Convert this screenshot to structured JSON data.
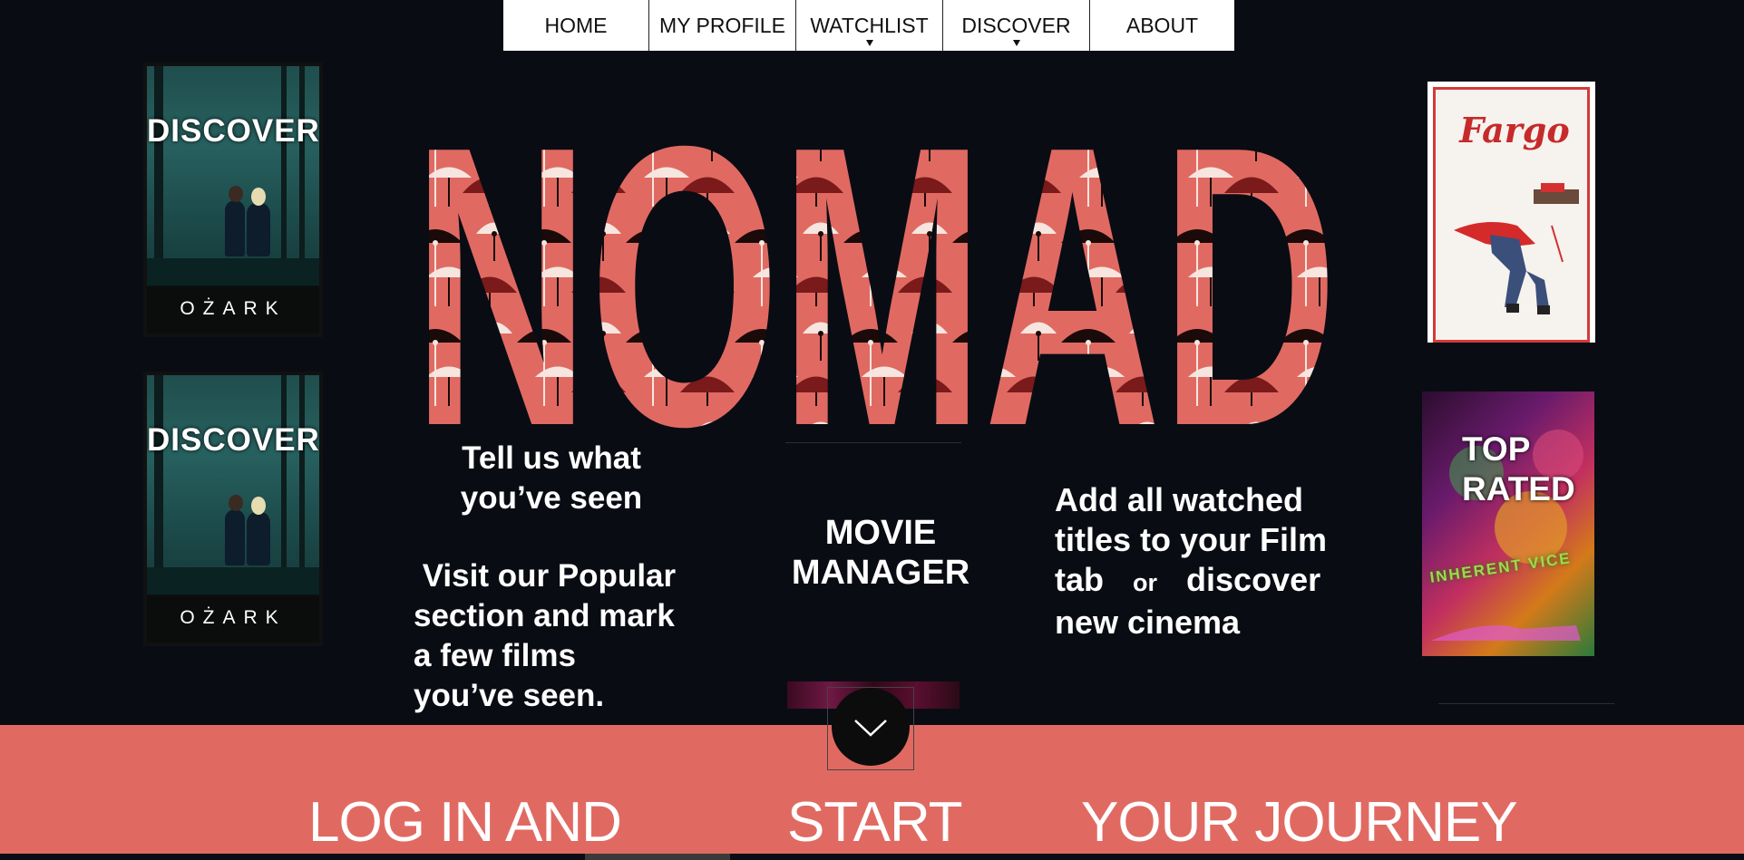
{
  "nav": {
    "items": [
      {
        "label": "HOME",
        "dropdown": false
      },
      {
        "label": "MY PROFILE",
        "dropdown": false
      },
      {
        "label": "WATCHLIST",
        "dropdown": true
      },
      {
        "label": "DISCOVER",
        "dropdown": true
      },
      {
        "label": "ABOUT",
        "dropdown": false
      }
    ]
  },
  "left_posters": {
    "top": {
      "label": "DISCOVER",
      "poster_title": "OŻARK"
    },
    "bottom": {
      "label": "DISCOVER",
      "poster_title": "OŻARK"
    }
  },
  "right_posters": {
    "top": {
      "logo": "Fargo"
    },
    "bottom": {
      "label_line1": "TOP",
      "label_line2": "RATED",
      "poster_title": "INHERENT VICE"
    }
  },
  "hero": {
    "title": "NOMAD"
  },
  "blocks": {
    "seen_line1": "Tell us what",
    "seen_line2": "you’ve seen",
    "popular_line1": " Visit our Popular",
    "popular_line2": "section and mark",
    "popular_line3": "a few films",
    "popular_line4": "you’ve seen.",
    "manager_line1": "MOVIE",
    "manager_line2": "MANAGER",
    "add_line1": "Add all watched",
    "add_line2": "titles to your Film",
    "add_line3_a": "tab",
    "add_line3_or": "or",
    "add_line3_b": "discover",
    "add_line4": "new cinema"
  },
  "footer": {
    "part1": "LOG IN AND",
    "part2": "START",
    "part3": "YOUR JOURNEY",
    "color": "#e06a62"
  },
  "colors": {
    "background": "#0a0c14",
    "accent": "#e06a62"
  },
  "icons": {
    "scroll": "chevron-down-icon",
    "dropdown": "caret-down-icon"
  }
}
